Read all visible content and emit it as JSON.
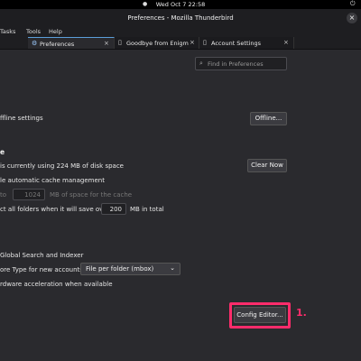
{
  "system_bar": {
    "clock": "Wed Oct 7  22:58"
  },
  "window": {
    "title": "Preferences - Mozilla Thunderbird",
    "close": "×"
  },
  "menu": [
    "Tasks",
    "Tools",
    "Help"
  ],
  "tabs": [
    {
      "label": "Preferences",
      "active": true
    },
    {
      "label": "Goodbye from Enigm",
      "active": false
    },
    {
      "label": "Account Settings",
      "active": false
    }
  ],
  "search": {
    "placeholder": "Find in Preferences"
  },
  "offline": {
    "label": "ffline settings",
    "button": "Offline..."
  },
  "cache": {
    "header": "e",
    "usage": "is currently using 224 MB of disk space",
    "clear_button": "Clear Now",
    "override_label": "le automatic cache management",
    "limit_prefix": "to",
    "limit_value": "1024",
    "limit_suffix": "MB of space for the cache",
    "compact_label": "ct all folders when it will save over",
    "compact_value": "200",
    "compact_suffix": "MB in total"
  },
  "advanced": {
    "search_label": "Global Search and Indexer",
    "store_label": "ore Type for new accounts:",
    "store_value": "File per folder (mbox)",
    "hw_label": "rdware acceleration when available"
  },
  "config": {
    "button": "Config Editor..."
  },
  "annotation": "1.",
  "colors": {
    "highlight": "#ff2c6b",
    "accent": "#5b9dd9"
  }
}
